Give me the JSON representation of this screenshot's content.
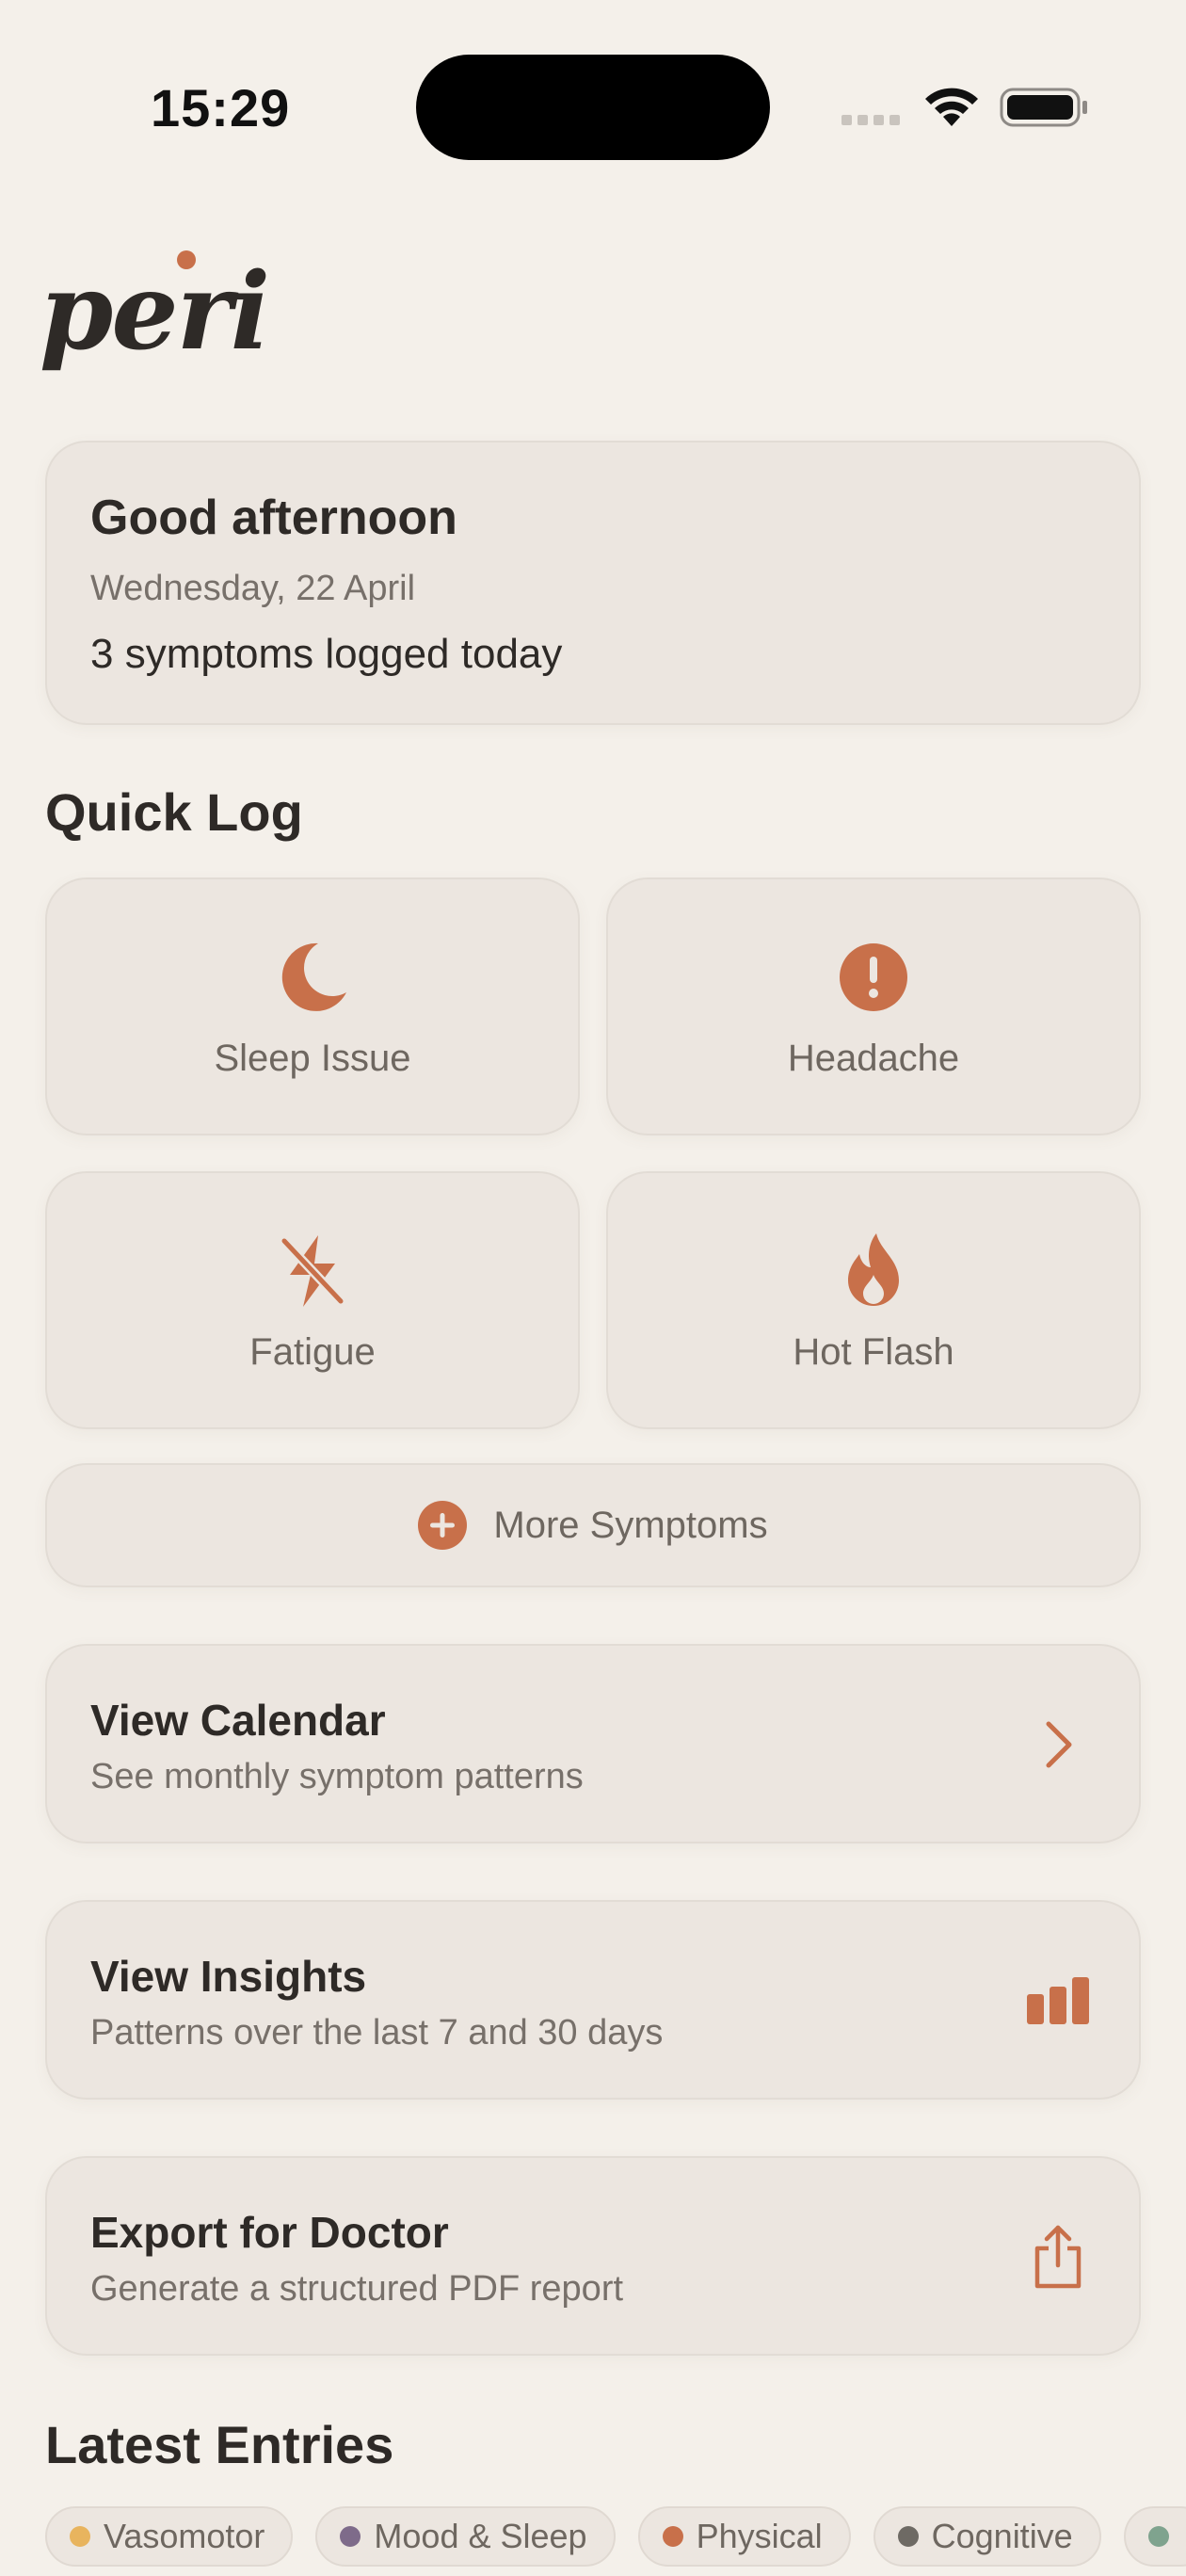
{
  "status_bar": {
    "time": "15:29"
  },
  "brand": {
    "logo_text": "peri",
    "accent": "#C8704A"
  },
  "greeting": {
    "title": "Good afternoon",
    "date": "Wednesday, 22 April",
    "count_text": "3 symptoms logged today"
  },
  "quick_log": {
    "title": "Quick Log",
    "tiles": [
      {
        "label": "Sleep Issue",
        "icon": "moon-icon"
      },
      {
        "label": "Headache",
        "icon": "exclamation-circle-icon"
      },
      {
        "label": "Fatigue",
        "icon": "bolt-slash-icon"
      },
      {
        "label": "Hot Flash",
        "icon": "flame-icon"
      }
    ],
    "more_label": "More Symptoms",
    "more_icon": "plus-circle-icon"
  },
  "nav_cards": [
    {
      "title": "View Calendar",
      "subtitle": "See monthly symptom patterns",
      "icon": "chevron-right-icon"
    },
    {
      "title": "View Insights",
      "subtitle": "Patterns over the last 7 and 30 days",
      "icon": "bar-chart-icon"
    },
    {
      "title": "Export for Doctor",
      "subtitle": "Generate a structured PDF report",
      "icon": "share-icon"
    }
  ],
  "latest": {
    "title": "Latest Entries",
    "filters": [
      {
        "label": "Vasomotor",
        "color": "#E8B45E"
      },
      {
        "label": "Mood & Sleep",
        "color": "#7E6B8A"
      },
      {
        "label": "Physical",
        "color": "#C8704A"
      },
      {
        "label": "Cognitive",
        "color": "#6E6A64"
      },
      {
        "label": "",
        "color": "#7FA38E"
      }
    ]
  }
}
